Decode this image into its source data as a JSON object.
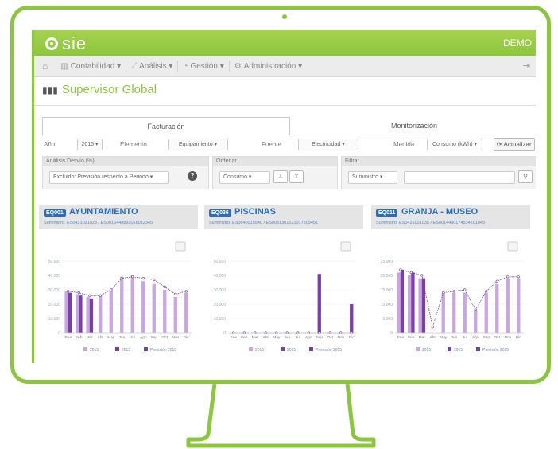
{
  "app": {
    "logo_text": "sie",
    "env_label": "DEMO"
  },
  "menu": {
    "home_icon": "home-icon",
    "items": [
      {
        "icon": "bar-chart-icon",
        "label": "Contabilidad"
      },
      {
        "icon": "line-chart-icon",
        "label": "Análisis"
      },
      {
        "icon": "gauge-icon",
        "label": "Gestión"
      },
      {
        "icon": "cogs-icon",
        "label": "Administración"
      }
    ],
    "logout_icon": "logout-icon"
  },
  "page": {
    "title": "Supervisor Global"
  },
  "tabs": [
    {
      "label": "Facturación",
      "active": true
    },
    {
      "label": "Monitorización",
      "active": false
    }
  ],
  "filters": {
    "year_label": "Año",
    "year_value": "2015",
    "element_label": "Elemento",
    "element_value": "Equipamiento",
    "source_label": "Fuente",
    "source_value": "Electricidad",
    "measure_label": "Medida",
    "measure_value": "Consumo (kWh)",
    "refresh_label": "Actualizar"
  },
  "panels": {
    "analysis_title": "Análisis Desvío (%)",
    "analysis_value": "Excluido: Previsión respecto a Periodo",
    "sort_title": "Ordenar",
    "sort_value": "Consumo",
    "filter_title": "Filtrar",
    "filter_value": "Suministro"
  },
  "colors": {
    "accent": "#8cc63f",
    "brand_blue": "#2d6db5",
    "bar_dark": "#7a3fa8",
    "bar_light": "#c9a6e0"
  },
  "cards": [
    {
      "badge": "EQ001",
      "title": "AYUNTAMIENTO",
      "supply": "Suministro: ES0421021023 / ES0016448892016012345"
    },
    {
      "badge": "EQ036",
      "title": "PISCINAS",
      "supply": "Suministro: ES0640015940 / ES0031301521017809451"
    },
    {
      "badge": "EQ011",
      "title": "GRANJA - MUSEO",
      "supply": "Suministro: ES0421021035 / ES0014490174534201845"
    }
  ],
  "chart_data": [
    {
      "type": "bar",
      "categories": [
        "Ene",
        "Feb",
        "Mar",
        "Abr",
        "May",
        "Jun",
        "Jul",
        "Ago",
        "Sep",
        "Oct",
        "Nov",
        "Dic"
      ],
      "ylim": [
        0,
        50000
      ],
      "yticks": [
        "0",
        "10.000",
        "20.000",
        "30.000",
        "40.000",
        "50.000"
      ],
      "series": [
        {
          "name": "2015",
          "values": [
            29000,
            27000,
            25000,
            0,
            0,
            0,
            0,
            0,
            0,
            0,
            0,
            0
          ]
        },
        {
          "name": "2015",
          "values": [
            28000,
            26000,
            24000,
            26000,
            30000,
            39000,
            40000,
            36000,
            34000,
            30000,
            25000,
            28000
          ]
        },
        {
          "name": "Previsión 2015",
          "values": [
            29000,
            28000,
            26000,
            26000,
            30000,
            38000,
            39000,
            38000,
            37000,
            32000,
            27000,
            29000
          ]
        }
      ],
      "legend": [
        "2015",
        "2015",
        "Previsión 2015"
      ]
    },
    {
      "type": "bar",
      "categories": [
        "Ene",
        "Feb",
        "Mar",
        "Abr",
        "May",
        "Jun",
        "Jul",
        "Ago",
        "Sep",
        "Oct",
        "Nov",
        "Dic"
      ],
      "ylim": [
        0,
        50000
      ],
      "yticks": [
        "0",
        "10.000",
        "20.000",
        "30.000",
        "40.000",
        "50.000"
      ],
      "series": [
        {
          "name": "2015",
          "values": [
            0,
            0,
            0,
            0,
            0,
            0,
            0,
            0,
            0,
            0,
            0,
            0
          ]
        },
        {
          "name": "2015",
          "values": [
            0,
            0,
            0,
            0,
            0,
            0,
            0,
            0,
            41000,
            0,
            0,
            20000
          ]
        },
        {
          "name": "Previsión 2015",
          "values": [
            0,
            0,
            0,
            0,
            0,
            0,
            0,
            0,
            0,
            0,
            0,
            0
          ]
        }
      ],
      "legend": [
        "2015",
        "2015",
        "Previsión 2015"
      ]
    },
    {
      "type": "bar",
      "categories": [
        "Ene",
        "Feb",
        "Mar",
        "Abr",
        "May",
        "Jun",
        "Jul",
        "Ago",
        "Sep",
        "Oct",
        "Nov",
        "Dic"
      ],
      "ylim": [
        0,
        25000
      ],
      "yticks": [
        "0",
        "5.000",
        "10.000",
        "15.000",
        "20.000",
        "25.000"
      ],
      "series": [
        {
          "name": "2015",
          "values": [
            21000,
            20000,
            19000,
            0,
            0,
            0,
            0,
            0,
            0,
            0,
            0,
            0
          ]
        },
        {
          "name": "2015",
          "values": [
            22000,
            21000,
            19000,
            0,
            14000,
            14000,
            14000,
            8000,
            14000,
            17000,
            19000,
            19000
          ]
        },
        {
          "name": "Previsión 2015",
          "values": [
            22000,
            21000,
            20000,
            2000,
            14000,
            14500,
            15000,
            8000,
            14500,
            18000,
            19500,
            19500
          ]
        }
      ],
      "legend": [
        "2015",
        "2015",
        "Previsión 2015"
      ]
    }
  ]
}
